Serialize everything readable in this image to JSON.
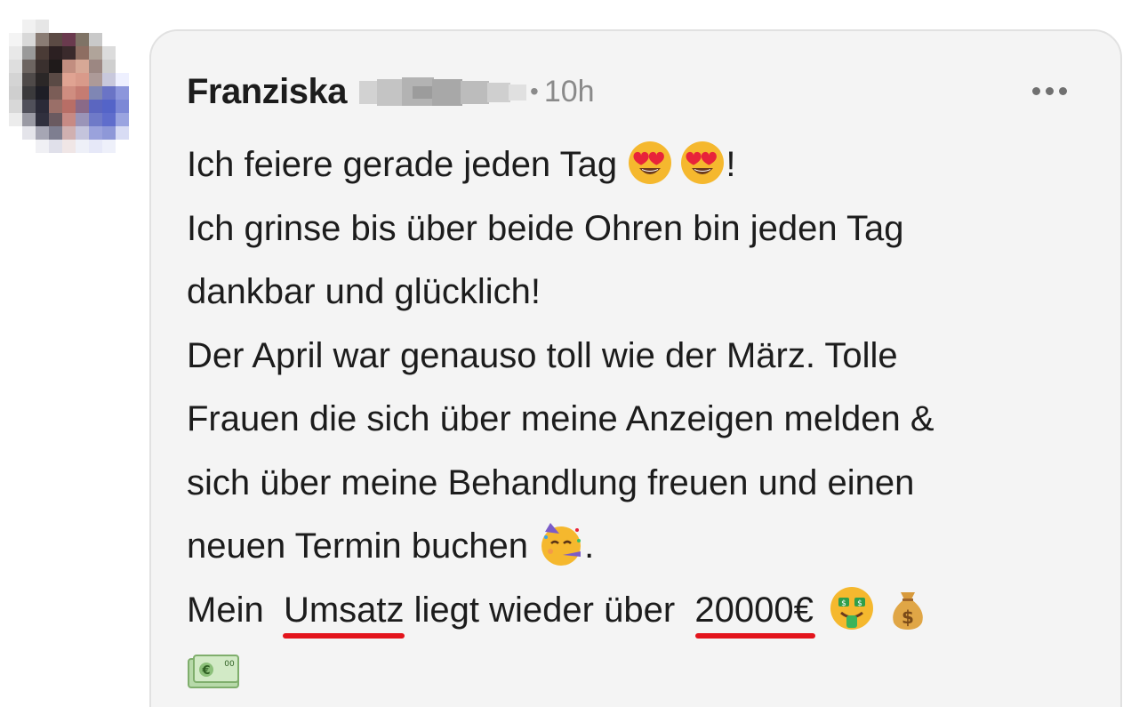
{
  "post": {
    "author_first_name": "Franziska",
    "separator": "•",
    "time_ago": "10h",
    "more_menu_icon": "ellipsis-horizontal-icon",
    "body": {
      "line1_text": "Ich feiere gerade jeden Tag",
      "line1_end": "!",
      "line1_emojis": [
        "heart-eyes-emoji",
        "heart-eyes-emoji"
      ],
      "line2": "Ich grinse bis über beide Ohren bin jeden Tag",
      "line3": "dankbar und glücklich!",
      "line4": "Der April war genauso toll wie der März. Tolle",
      "line5": "Frauen die sich über meine Anzeigen melden &",
      "line6": "sich über meine Behandlung freuen und einen",
      "line7_text": "neuen Termin buchen",
      "line7_end": ".",
      "line7_emoji": "party-face-emoji",
      "line8_a": "Mein",
      "line8_underlined_1": "Umsatz",
      "line8_b": "liegt wieder über",
      "line8_underlined_2": "20000€",
      "line8_emojis": [
        "money-mouth-emoji",
        "money-bag-emoji"
      ],
      "line9_emoji": "euro-banknote-emoji"
    },
    "colors": {
      "bubble_bg": "#f4f4f4",
      "bubble_border": "#e1e1e1",
      "text": "#1c1c1c",
      "meta": "#8a8a8a",
      "annotation_underline": "#e3141c"
    }
  }
}
